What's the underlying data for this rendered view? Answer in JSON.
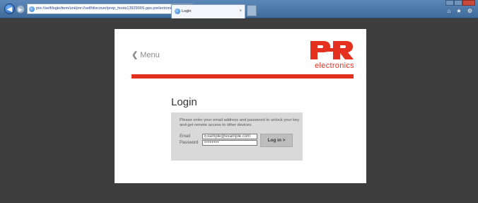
{
  "browser": {
    "address": "pre://self/login/item/uni/pre://self/discover/prep_hosts1392900S.pps.prelectronics.com",
    "address_controls": "▾ C",
    "tab_title": "Login",
    "tab_close": "×",
    "toolbar_icons": "⌂ ★ ⚙"
  },
  "page": {
    "menu_label": "Menu",
    "logo_text": "electronics",
    "logo_mark": "PR",
    "brand_color": "#e3301f",
    "login_title": "Login",
    "login_message": "Please enter your email address and password to unlock your key and get remote access to other devices.",
    "email_label": "Email",
    "email_value": "Example@example.com",
    "password_label": "Password",
    "password_value": "••••••••",
    "login_button": "Log in >"
  }
}
